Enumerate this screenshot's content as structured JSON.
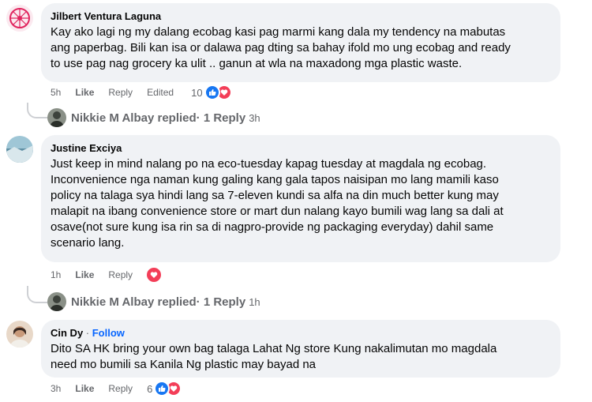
{
  "comments": [
    {
      "author": "Jilbert Ventura Laguna",
      "text": "Kay ako lagi ng my dalang ecobag kasi pag marmi kang dala my tendency na mabutas\nang paperbag. Bili kan isa or dalawa pag dting sa bahay ifold mo ung ecobag and ready\nto use pag nag grocery ka ulit .. ganun at wla na maxadong mga plastic waste.",
      "time": "5h",
      "like": "Like",
      "reply": "Reply",
      "edited": "Edited",
      "reaction_count": "10",
      "reactions": [
        "like-icon",
        "love-icon"
      ]
    },
    {
      "author": "Justine Exciya",
      "text": "Just keep in mind nalang po na eco-tuesday kapag tuesday at magdala ng ecobag.\nInconvenience nga naman kung galing kang gala tapos naisipan mo lang mamili kaso\npolicy na talaga sya hindi lang sa 7-eleven kundi sa alfa na din much better kung may\nmalapit na ibang convenience store or mart dun nalang kayo bumili wag lang sa dali at\nosave(not sure kung isa rin sa di nagpro-provide ng packaging everyday) dahil same\nscenario lang.",
      "time": "1h",
      "like": "Like",
      "reply": "Reply",
      "reactions": [
        "love-icon"
      ]
    },
    {
      "author": "Cin Dy",
      "follow_sep": " · ",
      "follow": "Follow",
      "text": "Dito SA HK bring your own bag talaga Lahat Ng store Kung nakalimutan mo magdala\nneed mo bumili sa Kanila Ng plastic may bayad na",
      "time": "3h",
      "like": "Like",
      "reply": "Reply",
      "reaction_count": "6",
      "reactions": [
        "like-icon",
        "love-icon"
      ]
    }
  ],
  "replies": [
    {
      "name": "Nikkie M Albay replied",
      "count": " · 1 Reply",
      "time": "3h"
    },
    {
      "name": "Nikkie M Albay replied",
      "count": " · 1 Reply",
      "time": "1h"
    }
  ],
  "colors": {
    "bubble": "#f0f2f5",
    "secondary_text": "#65676b",
    "like_blue": "#1877f2",
    "love_red": "#f33e58",
    "follow_blue": "#0866ff"
  }
}
